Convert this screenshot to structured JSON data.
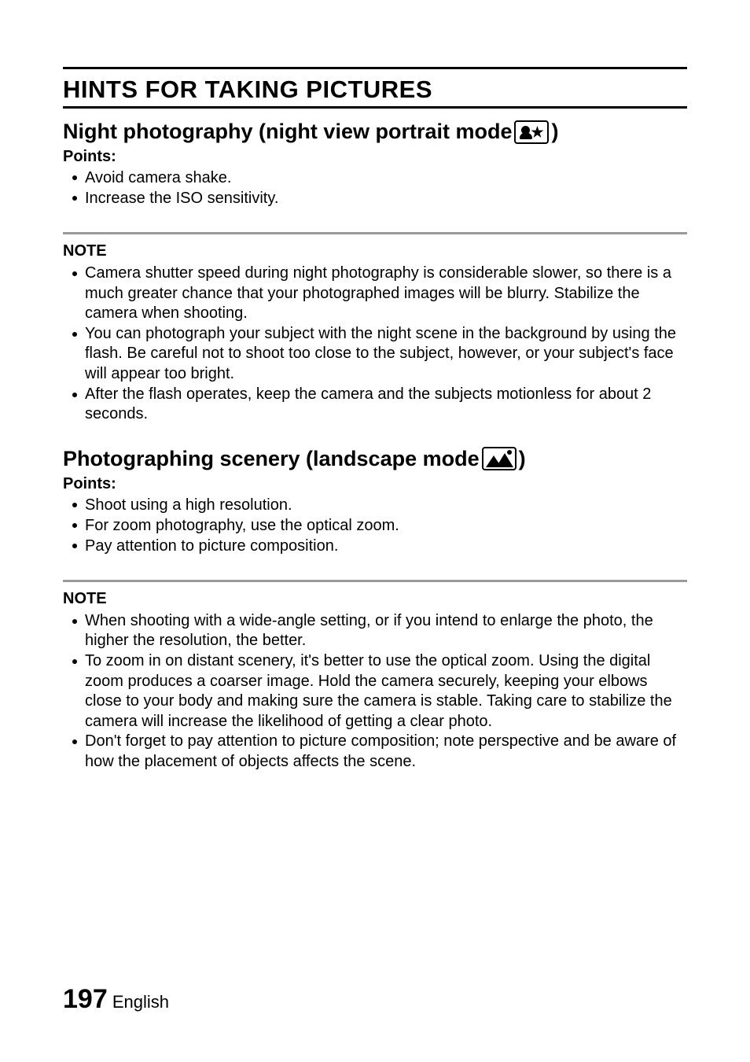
{
  "main_title": "HINTS FOR TAKING PICTURES",
  "sections": [
    {
      "heading_prefix": "Night photography (night view portrait mode ",
      "heading_suffix": ")",
      "points_label": "Points:",
      "points": [
        "Avoid camera shake.",
        "Increase the ISO sensitivity."
      ],
      "note_label": "NOTE",
      "notes": [
        "Camera shutter speed during night photography is considerable slower, so there is a much greater chance that your photographed images will be blurry. Stabilize the camera when shooting.",
        "You can photograph your subject with the night scene in the background by using the flash. Be careful not to shoot too close to the subject, however, or your subject's face will appear too bright.",
        "After the flash operates, keep the camera and the subjects motionless for about 2 seconds."
      ]
    },
    {
      "heading_prefix": "Photographing scenery (landscape mode ",
      "heading_suffix": ")",
      "points_label": "Points:",
      "points": [
        "Shoot using a high resolution.",
        "For zoom photography, use the optical zoom.",
        "Pay attention to picture composition."
      ],
      "note_label": "NOTE",
      "notes": [
        "When shooting with a wide-angle setting, or if you intend to enlarge the photo, the higher the resolution, the better.",
        "To zoom in on distant scenery, it's better to use the optical zoom. Using the digital zoom produces a coarser image. Hold the camera securely, keeping your elbows close to your body and making sure the camera is stable. Taking care to stabilize the camera will increase the likelihood of getting a clear photo.",
        "Don't forget to pay attention to picture composition; note perspective and be aware of how the placement of objects affects the scene."
      ]
    }
  ],
  "footer": {
    "page_number": "197",
    "language": " English"
  }
}
